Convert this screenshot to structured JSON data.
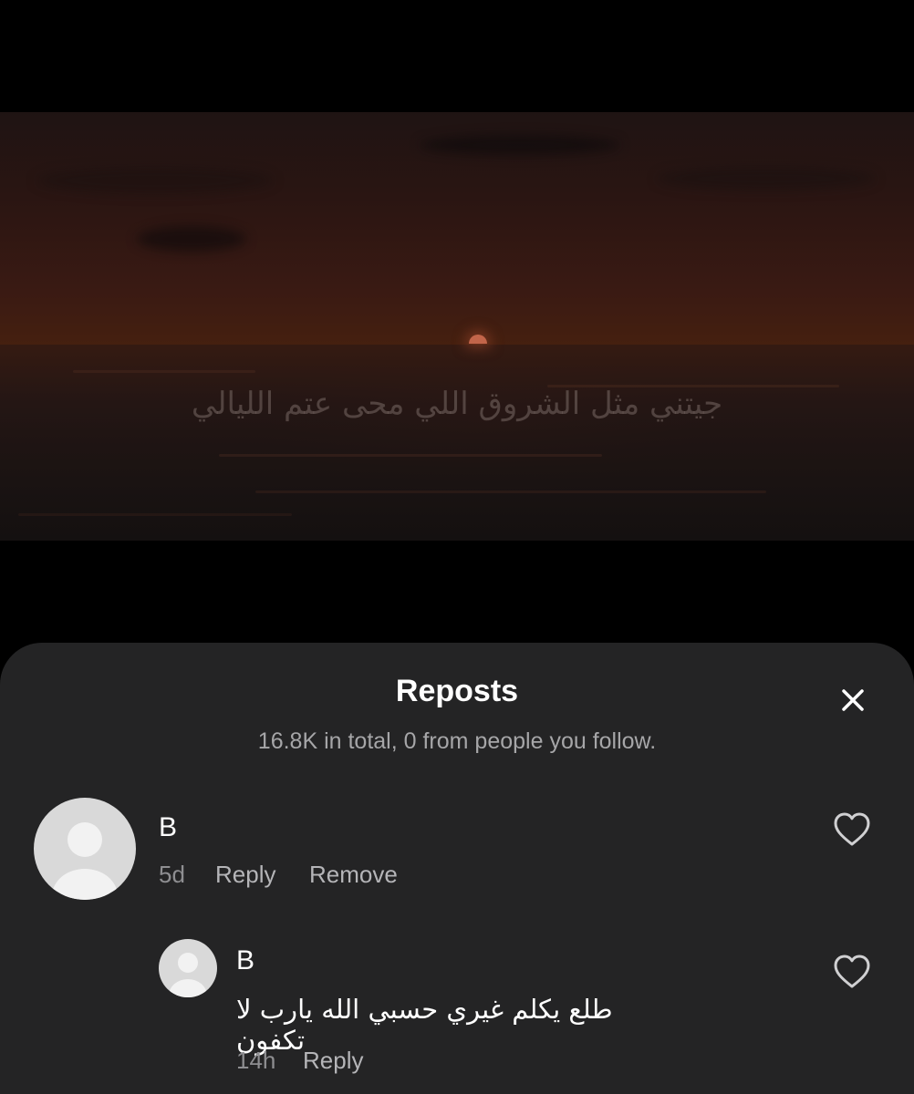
{
  "video": {
    "lyric": "جيتني مثل الشروق اللي محى عتم الليالي"
  },
  "reposts_sheet": {
    "title": "Reposts",
    "subtitle": "16.8K in total, 0 from people you follow.",
    "close_icon": "close-icon"
  },
  "comments": [
    {
      "username": "B",
      "time": "5d",
      "reply_label": "Reply",
      "remove_label": "Remove",
      "avatar_icon": "default-avatar-icon",
      "like_icon": "heart-outline-icon"
    }
  ],
  "replies": [
    {
      "username": "B",
      "text": "طلع يكلم غيري حسبي الله يارب لا تكفون",
      "time": "14h",
      "reply_label": "Reply",
      "avatar_icon": "default-avatar-icon",
      "like_icon": "heart-outline-icon"
    }
  ],
  "colors": {
    "background": "#000000",
    "sheet": "#242425",
    "primary_text": "#ffffff",
    "secondary_text": "#a6a6a8"
  }
}
